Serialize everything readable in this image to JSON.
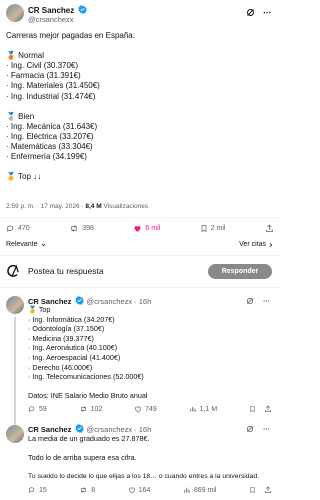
{
  "main_tweet": {
    "display_name": "CR Sanchez",
    "handle": "@crsanchezx",
    "lines": [
      "Carreras mejor pagadas en España:",
      "",
      "🥉 Normal",
      "· Ing. Civil (30.370€)",
      "· Farmacia (31.391€)",
      "· Ing. Materiales (31.450€)",
      "· Ing. Industrial (31.474€)",
      "",
      "🥈 Bien",
      "· Ing. Mecánica (31.643€)",
      "· Ing. Eléctrica (33.207€)",
      "· Matemáticas (33.304€)",
      "· Enfermería (34.199€)",
      "",
      "🥇 Top ↓↓"
    ],
    "timestamp": "2:59 p. m. · 17 may. 2026 · ",
    "views_count": "8,4 M",
    "views_label": "Visualizaciones",
    "stats": {
      "replies": "470",
      "reposts": "398",
      "likes": "6 mil",
      "bookmarks": "2 mil"
    },
    "sort_label": "Relevante",
    "quotes_label": "Ver citas"
  },
  "composer": {
    "placeholder": "Postea tu respuesta",
    "button": "Responder"
  },
  "replies": [
    {
      "display_name": "CR Sanchez",
      "meta": "@crsanchezx · 16h",
      "lines": [
        "🥇 Top",
        "· Ing. Informática (34.207€)",
        "· Odontología (37.150€)",
        "· Medicina (39.377€)",
        "· Ing. Aeronáutica (40.100€)",
        "· Ing. Aeroespacial (41.400€)",
        "· Derecho (46.000€)",
        "· Ing. Telecomunicaciones (52.000€)",
        "",
        "Datos: INE Salario Medio Bruto anual"
      ],
      "stats": {
        "replies": "59",
        "reposts": "102",
        "likes": "749",
        "views": "1,1 M"
      }
    },
    {
      "display_name": "CR Sanchez",
      "meta": "@crsanchezx · 16h",
      "lines": [
        "La media de un graduado es 27.878€.",
        "",
        "Todo lo de arriba supera esa cifra.",
        "",
        "Tu sueldo lo decide lo que elijas a los 18… o cuando entres a la universidad."
      ],
      "stats": {
        "replies": "15",
        "reposts": "8",
        "likes": "164",
        "views": "869 mil"
      }
    }
  ],
  "colors": {
    "like_active": "#f91880",
    "verified": "#1d9bf0",
    "button_bg": "#87898c"
  },
  "icons": [
    "verified-badge-icon",
    "grok-icon",
    "more-icon",
    "reply-icon",
    "repost-icon",
    "like-icon",
    "bookmark-icon",
    "share-icon",
    "views-icon",
    "chevron-down-icon",
    "logo-icon"
  ]
}
